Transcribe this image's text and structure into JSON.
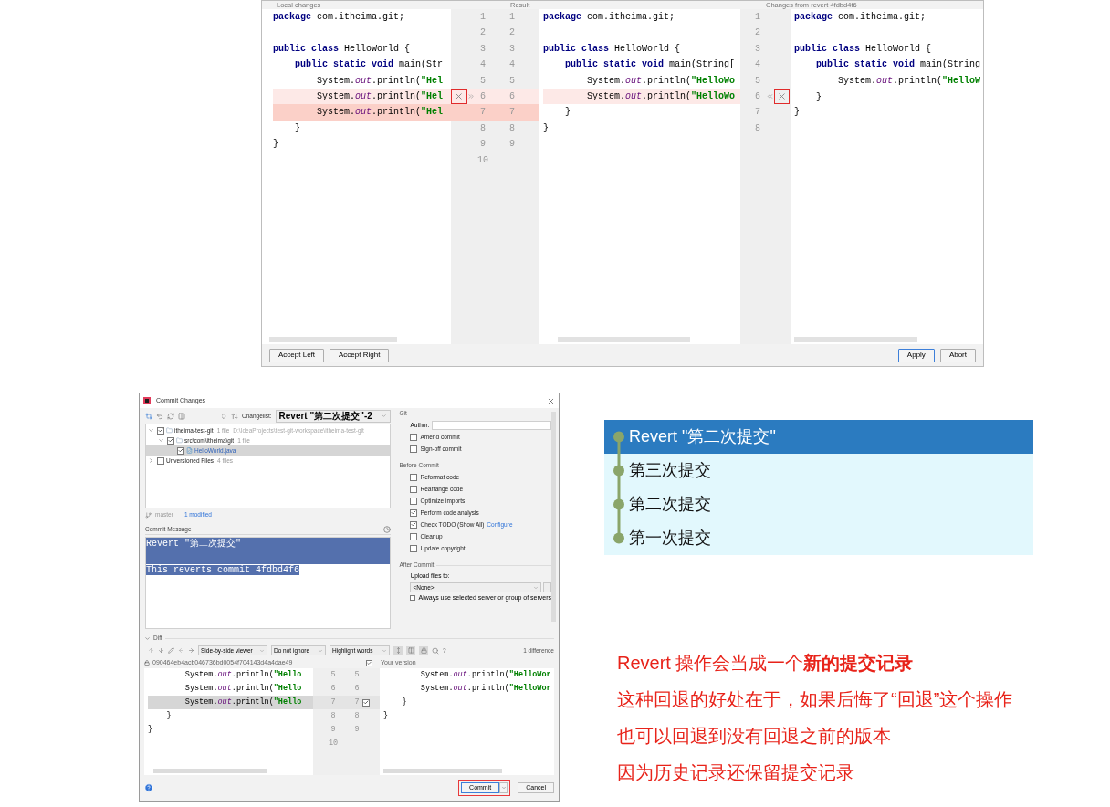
{
  "merge_window": {
    "pane_titles": [
      "Local changes",
      "Result",
      "Changes from revert 4fdbd4f6"
    ],
    "left_lines": [
      {
        "kind": "plain",
        "segs": [
          {
            "kind": "kw",
            "text": "package"
          },
          {
            "kind": "plain",
            "text": " com.itheima.git;"
          }
        ]
      },
      {
        "kind": "plain"
      },
      {
        "kind": "plain",
        "segs": [
          {
            "kind": "kw",
            "text": "public class"
          },
          {
            "kind": "plain",
            "text": " HelloWorld {"
          }
        ]
      },
      {
        "kind": "plain",
        "segs": [
          {
            "kind": "kw",
            "text": "    public static void"
          },
          {
            "kind": "plain",
            "text": " main(Str"
          }
        ]
      },
      {
        "kind": "plain",
        "segs": [
          {
            "kind": "plain",
            "text": "        System."
          },
          {
            "kind": "field",
            "text": "out"
          },
          {
            "kind": "plain",
            "text": ".println("
          },
          {
            "kind": "str",
            "text": "\"Hel"
          }
        ]
      },
      {
        "kind": "changed",
        "segs": [
          {
            "kind": "plain",
            "text": "        System."
          },
          {
            "kind": "field",
            "text": "out"
          },
          {
            "kind": "plain",
            "text": ".println("
          },
          {
            "kind": "str",
            "text": "\"Hel"
          }
        ]
      },
      {
        "kind": "added",
        "segs": [
          {
            "kind": "plain",
            "text": "        System."
          },
          {
            "kind": "field",
            "text": "out"
          },
          {
            "kind": "plain",
            "text": ".println("
          },
          {
            "kind": "str",
            "text": "\"Hel"
          }
        ]
      },
      {
        "kind": "plain",
        "segs": [
          {
            "kind": "plain",
            "text": "    }"
          }
        ]
      },
      {
        "kind": "plain",
        "segs": [
          {
            "kind": "plain",
            "text": "}"
          }
        ]
      }
    ],
    "left_numbers": [
      "1",
      "2",
      "3",
      "4",
      "5",
      "6",
      "7",
      "8",
      "9",
      "10"
    ],
    "result_numbers": [
      "1",
      "2",
      "3",
      "4",
      "5",
      "6",
      "7",
      "8",
      "9"
    ],
    "result_lines": [
      {
        "kind": "plain",
        "segs": [
          {
            "kind": "kw",
            "text": "package"
          },
          {
            "kind": "plain",
            "text": " com.itheima.git;"
          }
        ]
      },
      {
        "kind": "plain"
      },
      {
        "kind": "plain",
        "segs": [
          {
            "kind": "kw",
            "text": "public class"
          },
          {
            "kind": "plain",
            "text": " HelloWorld {"
          }
        ]
      },
      {
        "kind": "plain",
        "segs": [
          {
            "kind": "kw",
            "text": "    public static void"
          },
          {
            "kind": "plain",
            "text": " main(String["
          }
        ]
      },
      {
        "kind": "plain",
        "segs": [
          {
            "kind": "plain",
            "text": "        System."
          },
          {
            "kind": "field",
            "text": "out"
          },
          {
            "kind": "plain",
            "text": ".println("
          },
          {
            "kind": "str",
            "text": "\"HelloWo"
          }
        ]
      },
      {
        "kind": "changed",
        "segs": [
          {
            "kind": "plain",
            "text": "        System."
          },
          {
            "kind": "field",
            "text": "out"
          },
          {
            "kind": "plain",
            "text": ".println("
          },
          {
            "kind": "str",
            "text": "\"HelloWo"
          }
        ]
      },
      {
        "kind": "plain",
        "segs": [
          {
            "kind": "plain",
            "text": "    }"
          }
        ]
      },
      {
        "kind": "plain",
        "segs": [
          {
            "kind": "plain",
            "text": "}"
          }
        ]
      }
    ],
    "right_numbers": [
      "1",
      "2",
      "3",
      "4",
      "5",
      "6",
      "7",
      "8"
    ],
    "right_lines": [
      {
        "kind": "plain",
        "segs": [
          {
            "kind": "kw",
            "text": "package"
          },
          {
            "kind": "plain",
            "text": " com.itheima.git;"
          }
        ]
      },
      {
        "kind": "plain"
      },
      {
        "kind": "plain",
        "segs": [
          {
            "kind": "kw",
            "text": "public class"
          },
          {
            "kind": "plain",
            "text": " HelloWorld {"
          }
        ]
      },
      {
        "kind": "plain",
        "segs": [
          {
            "kind": "kw",
            "text": "    public static void"
          },
          {
            "kind": "plain",
            "text": " main(String"
          }
        ]
      },
      {
        "kind": "plain",
        "segs": [
          {
            "kind": "plain",
            "text": "        System."
          },
          {
            "kind": "field",
            "text": "out"
          },
          {
            "kind": "plain",
            "text": ".println("
          },
          {
            "kind": "str",
            "text": "\"HelloW"
          }
        ]
      },
      {
        "kind": "removed",
        "segs": [
          {
            "kind": "plain",
            "text": "    }"
          }
        ]
      },
      {
        "kind": "plain",
        "segs": [
          {
            "kind": "plain",
            "text": "}"
          }
        ]
      }
    ],
    "left_buttons": [
      {
        "label": "Accept Left",
        "default": false
      },
      {
        "label": "Accept Right",
        "default": false
      }
    ],
    "right_buttons": [
      {
        "label": "Apply",
        "default": true
      },
      {
        "label": "Abort",
        "default": false
      }
    ]
  },
  "commit_dialog": {
    "title": "Commit Changes",
    "changelist_label": "Changelist:",
    "changelist": "Revert \"第二次提交\"-2",
    "tree": [
      {
        "name": "itheima-test-git",
        "count": "1 file",
        "path": "D:\\IdeaProjects\\test-git-workspace\\itheima-test-git",
        "checked": true,
        "selected": false,
        "expanded": true,
        "children": [
          {
            "name": "src\\com\\itheima\\git",
            "count": "1 file",
            "checked": true,
            "selected": false,
            "expanded": true,
            "children": [
              {
                "name": "HelloWorld.java",
                "checked": true,
                "selected": true
              }
            ]
          }
        ]
      },
      {
        "name": "Unversioned Files",
        "count": "4 files",
        "checked": false,
        "selected": false,
        "expanded": false
      }
    ],
    "branch": "master",
    "modified": "1 modified",
    "message_label": "Commit Message",
    "message_paragraphs": [
      "Revert \"第二次提交\"",
      "This reverts commit 4fdbd4f6"
    ],
    "git_label": "Git",
    "author_label": "Author:",
    "git_options": [
      {
        "label": "Amend commit",
        "checked": false
      },
      {
        "label": "Sign-off commit",
        "checked": false
      }
    ],
    "before_label": "Before Commit",
    "before_options": [
      {
        "label": "Reformat code",
        "checked": false
      },
      {
        "label": "Rearrange code",
        "checked": false
      },
      {
        "label": "Optimize imports",
        "checked": false
      },
      {
        "label": "Perform code analysis",
        "checked": true
      },
      {
        "label": "Check TODO (Show All)",
        "checked": true,
        "link": "Configure"
      },
      {
        "label": "Cleanup",
        "checked": false
      },
      {
        "label": "Update copyright",
        "checked": false
      }
    ],
    "after_label": "After Commit",
    "upload_label": "Upload files to:",
    "upload_value": "<None>",
    "always_option": {
      "label": "Always use selected server or group of servers",
      "checked": false
    },
    "diff_label": "Diff",
    "diff_expanded": true,
    "viewer": "Side-by-side viewer",
    "ignore": "Do not ignore",
    "highlight": "Highlight words",
    "help": "?",
    "differences": "1 difference",
    "left_hash": "090464eb4acb046736bd0054f704143d4a4dae49",
    "right_title": "Your version",
    "right_checked": true,
    "change_included": true,
    "diff_left_lines": [
      {
        "kind": "plain",
        "segs": [
          {
            "kind": "plain",
            "text": "        System."
          },
          {
            "kind": "field",
            "text": "out"
          },
          {
            "kind": "plain",
            "text": ".println("
          },
          {
            "kind": "str",
            "text": "\"Hello"
          }
        ]
      },
      {
        "kind": "plain",
        "segs": [
          {
            "kind": "plain",
            "text": "        System."
          },
          {
            "kind": "field",
            "text": "out"
          },
          {
            "kind": "plain",
            "text": ".println("
          },
          {
            "kind": "str",
            "text": "\"Hello"
          }
        ]
      },
      {
        "kind": "selected",
        "segs": [
          {
            "kind": "plain",
            "text": "        System."
          },
          {
            "kind": "field",
            "text": "out"
          },
          {
            "kind": "plain",
            "text": ".println("
          },
          {
            "kind": "str",
            "text": "\"Hello"
          }
        ]
      },
      {
        "kind": "plain",
        "segs": [
          {
            "kind": "plain",
            "text": "    }"
          }
        ]
      },
      {
        "kind": "plain",
        "segs": [
          {
            "kind": "plain",
            "text": "}"
          }
        ]
      }
    ],
    "diff_left_numbers": [
      "5",
      "6",
      "7",
      "8",
      "9",
      "10"
    ],
    "diff_right_numbers": [
      "5",
      "6",
      "7",
      "8",
      "9"
    ],
    "diff_right_lines": [
      {
        "segs": [
          {
            "kind": "plain",
            "text": "        System."
          },
          {
            "kind": "field",
            "text": "out"
          },
          {
            "kind": "plain",
            "text": ".println("
          },
          {
            "kind": "str",
            "text": "\"HelloWor"
          }
        ]
      },
      {
        "segs": [
          {
            "kind": "plain",
            "text": "        System."
          },
          {
            "kind": "field",
            "text": "out"
          },
          {
            "kind": "plain",
            "text": ".println("
          },
          {
            "kind": "str",
            "text": "\"HelloWor"
          }
        ]
      },
      {
        "segs": [
          {
            "kind": "plain",
            "text": "    }"
          }
        ]
      },
      {
        "segs": [
          {
            "kind": "plain",
            "text": "}"
          }
        ]
      }
    ],
    "commit_button": "Commit",
    "cancel_button": "Cancel"
  },
  "history": [
    {
      "label": "Revert \"第二次提交\"",
      "selected": true
    },
    {
      "label": "第三次提交",
      "selected": false
    },
    {
      "label": "第二次提交",
      "selected": false
    },
    {
      "label": "第一次提交",
      "selected": false
    }
  ],
  "notes": [
    "Revert 操作会当成一个**新的提交记录**",
    "这种回退的好处在于，如果后悔了“回退”这个操作",
    "也可以回退到没有回退之前的版本",
    "因为历史记录还保留提交记录"
  ]
}
